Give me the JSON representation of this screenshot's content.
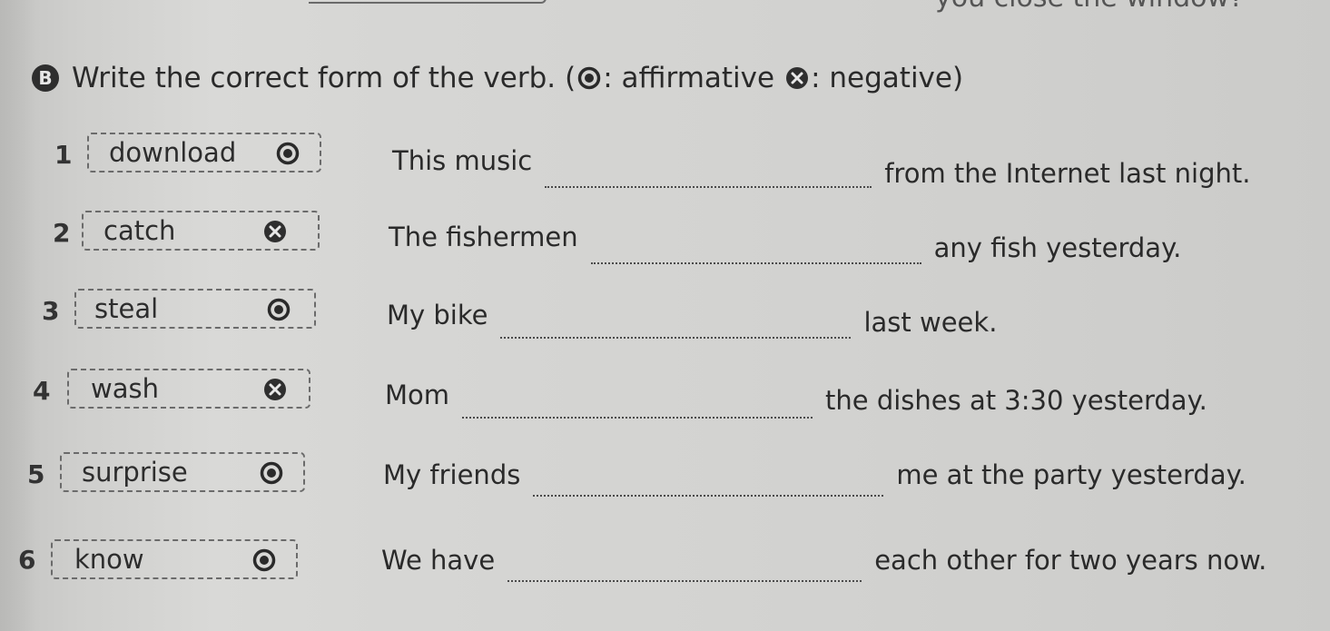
{
  "top_cut": {
    "trailing_text": "you close the window?"
  },
  "exercise": {
    "label": "B",
    "instruction": "Write the correct form of the verb.",
    "legend_open": "(",
    "legend_affirmative": ": affirmative",
    "legend_negative": ": negative)",
    "affirmative_icon": "circle-dot-icon",
    "negative_icon": "circle-x-icon"
  },
  "items": [
    {
      "number": "1",
      "verb": "download",
      "form": "affirmative",
      "before": "This music",
      "after": "from the Internet last night."
    },
    {
      "number": "2",
      "verb": "catch",
      "form": "negative",
      "before": "The fishermen",
      "after": "any fish yesterday."
    },
    {
      "number": "3",
      "verb": "steal",
      "form": "affirmative",
      "before": "My bike",
      "after": "last week."
    },
    {
      "number": "4",
      "verb": "wash",
      "form": "negative",
      "before": "Mom",
      "after": "the dishes at 3:30 yesterday."
    },
    {
      "number": "5",
      "verb": "surprise",
      "form": "affirmative",
      "before": "My friends",
      "after": "me at the party yesterday."
    },
    {
      "number": "6",
      "verb": "know",
      "form": "affirmative",
      "before": "We have",
      "after": "each other for two years now."
    }
  ],
  "colors": {
    "paper": "#d5d5d3",
    "ink": "#2b2b2b"
  }
}
